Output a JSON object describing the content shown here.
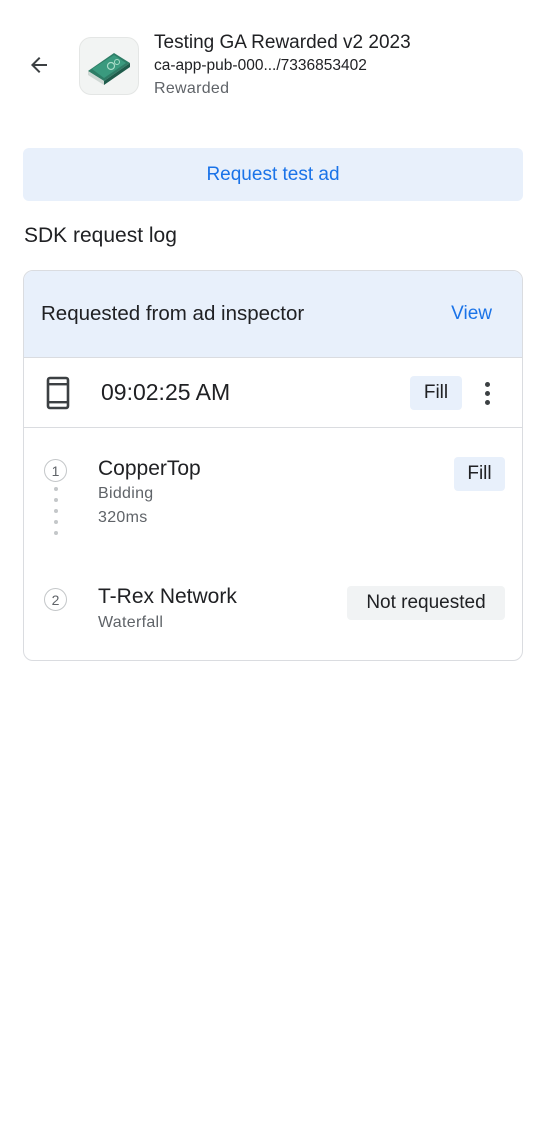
{
  "header": {
    "back_icon": "arrow-back-icon",
    "app_icon": "ad-app-icon",
    "title": "Testing GA Rewarded v2 2023",
    "ad_unit_id": "ca-app-pub-000.../7336853402",
    "format": "Rewarded"
  },
  "request_button": {
    "label": "Request test ad"
  },
  "log": {
    "section_title": "SDK request log",
    "card": {
      "title": "Requested from ad inspector",
      "view_label": "View",
      "request": {
        "device_icon": "phone-device-icon",
        "time": "09:02:25 AM",
        "status": "Fill",
        "menu_icon": "more-vert-icon"
      },
      "networks": [
        {
          "index": "1",
          "name": "CopperTop",
          "type": "Bidding",
          "latency": "320ms",
          "status": "Fill"
        },
        {
          "index": "2",
          "name": "T-Rex Network",
          "type": "Waterfall",
          "status": "Not requested"
        }
      ]
    }
  },
  "colors": {
    "accent": "#1a73e8",
    "highlight_bg": "#e8f0fb",
    "chip_grey": "#f1f3f4",
    "border": "#dadce0"
  }
}
